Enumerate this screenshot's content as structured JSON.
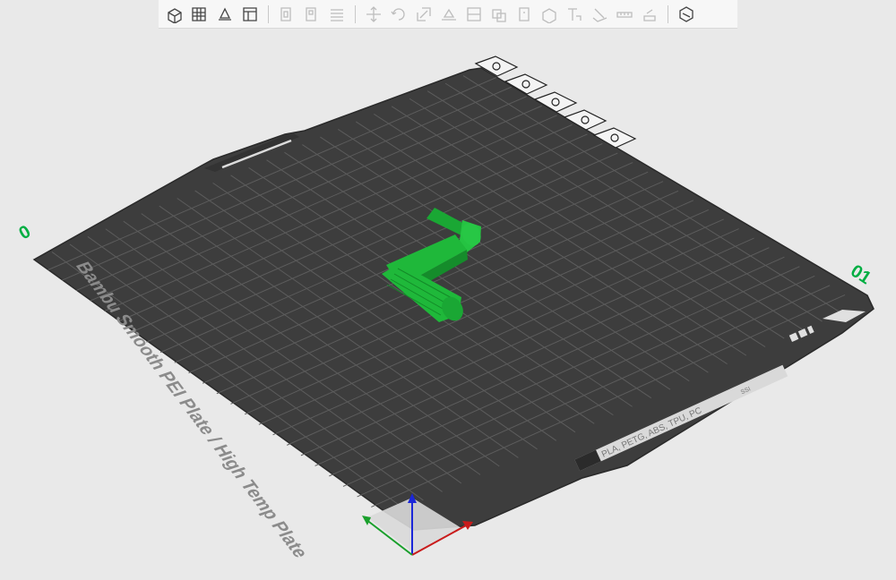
{
  "toolbar": {
    "groups": [
      [
        "add-object-icon",
        "add-plate-icon",
        "auto-orient-icon",
        "arrange-icon"
      ],
      [
        "split-objects-icon",
        "split-parts-icon",
        "layers-icon"
      ],
      [
        "move-icon",
        "rotate-icon",
        "scale-icon",
        "lay-on-face-icon",
        "cut-icon",
        "boolean-icon",
        "support-paint-icon",
        "seam-paint-icon",
        "text-icon",
        "color-paint-icon",
        "measure-icon",
        "assembly-icon"
      ],
      [
        "assembly-view-icon"
      ]
    ]
  },
  "plate": {
    "name": "Bambu Smooth PEI Plate / High Temp Plate",
    "materials": "PLA, PETG, ABS, TPU, PC",
    "plate_number": "01",
    "corner_mark": "0",
    "side_code": "SSI",
    "controls": [
      "close-plate-icon",
      "orient-plate-icon",
      "arrange-plate-icon",
      "lock-plate-icon",
      "plate-settings-icon"
    ]
  },
  "colors": {
    "plate": "#3d3d3d",
    "grid": "#5a5a5a",
    "model": "#1fb83a",
    "accent_green": "#00ae42"
  }
}
